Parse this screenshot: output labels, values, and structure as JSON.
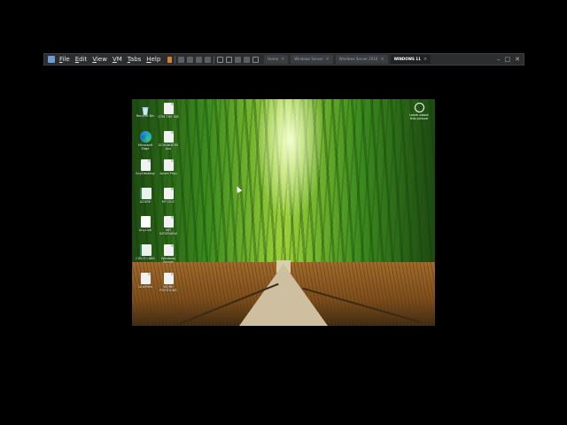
{
  "vm_window": {
    "menu": [
      "File",
      "Edit",
      "View",
      "VM",
      "Tabs",
      "Help"
    ],
    "tabs": [
      {
        "label": "Home",
        "active": false
      },
      {
        "label": "Windows Server",
        "active": false
      },
      {
        "label": "Windows Server 2016",
        "active": false
      },
      {
        "label": "WINDOWS 11",
        "active": true
      }
    ],
    "window_controls": [
      "–",
      "□",
      "✕"
    ]
  },
  "desktop": {
    "top_right_icon": {
      "label": "Learn about this picture",
      "icon": "camera-icon"
    },
    "icons": [
      {
        "label": "Recycle Bin",
        "icon": "recycle-bin-icon",
        "kind": "recycle"
      },
      {
        "label": "GTM THE ISB",
        "icon": "document-icon",
        "kind": "doc"
      },
      {
        "label": "Microsoft Edge",
        "icon": "edge-icon",
        "kind": "edge"
      },
      {
        "label": "SCHANDERS Azu",
        "icon": "document-icon",
        "kind": "doc"
      },
      {
        "label": "AnyDesktop",
        "icon": "document-icon",
        "kind": "doc"
      },
      {
        "label": "Azure Prop",
        "icon": "document-icon",
        "kind": "doc"
      },
      {
        "label": "AZURE",
        "icon": "spreadsheet-icon",
        "kind": "xls"
      },
      {
        "label": "MY DOC",
        "icon": "document-icon",
        "kind": "doc"
      },
      {
        "label": "AnyLink",
        "icon": "shortcut-icon",
        "kind": "link"
      },
      {
        "label": "MIT INTERVIEW",
        "icon": "document-icon",
        "kind": "doc"
      },
      {
        "label": "CISCO LABS",
        "icon": "spreadsheet-icon",
        "kind": "xls"
      },
      {
        "label": "Windows Server",
        "icon": "document-icon",
        "kind": "doc"
      },
      {
        "label": "LinkFiles",
        "icon": "document-icon",
        "kind": "doc"
      },
      {
        "label": "WORK POSITIONS",
        "icon": "document-icon",
        "kind": "doc"
      }
    ]
  },
  "colors": {
    "toolbar_bg": "#2b2d2f",
    "accent_orange": "#e07b2a",
    "page_bg": "#000000"
  }
}
